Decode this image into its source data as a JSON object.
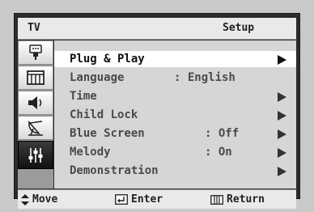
{
  "header": {
    "tv_label": "TV",
    "title": "Setup"
  },
  "icons": [
    {
      "name": "input-icon",
      "active": false
    },
    {
      "name": "picture-icon",
      "active": false
    },
    {
      "name": "sound-icon",
      "active": false
    },
    {
      "name": "channel-icon",
      "active": false
    },
    {
      "name": "setup-icon",
      "active": true
    }
  ],
  "menu": {
    "items": [
      {
        "label": "Plug & Play",
        "value": "",
        "arrow": true,
        "selected": true
      },
      {
        "label": "Language",
        "value": ": English",
        "arrow": false,
        "selected": false
      },
      {
        "label": "Time",
        "value": "",
        "arrow": true,
        "selected": false
      },
      {
        "label": "Child Lock",
        "value": "",
        "arrow": true,
        "selected": false
      },
      {
        "label": "Blue Screen",
        "value": ": Off",
        "arrow": true,
        "selected": false
      },
      {
        "label": "Melody",
        "value": ": On",
        "arrow": true,
        "selected": false
      },
      {
        "label": "Demonstration",
        "value": "",
        "arrow": true,
        "selected": false
      }
    ]
  },
  "footer": {
    "move": "Move",
    "enter": "Enter",
    "return": "Return"
  },
  "colors": {
    "selected_bg": "#ffffff",
    "content_bg": "#d6d6d6",
    "frame": "#2b2b2b"
  }
}
